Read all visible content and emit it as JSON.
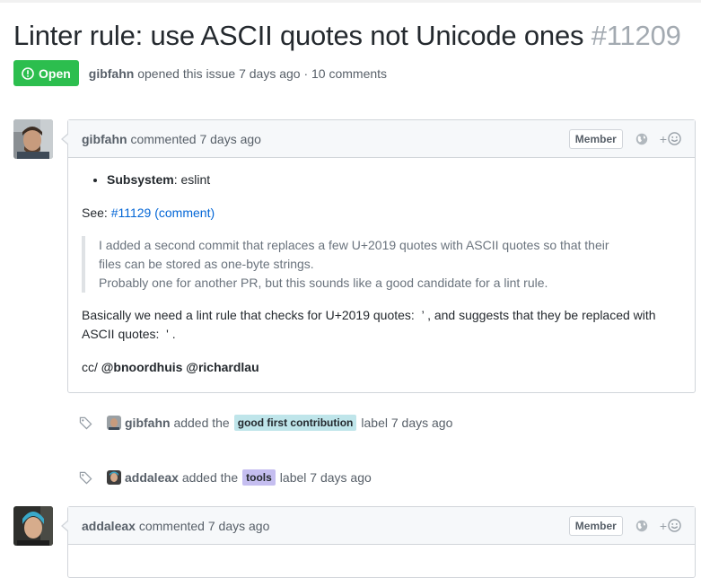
{
  "issue": {
    "title": "Linter rule: use ASCII quotes not Unicode ones",
    "number": "#11209",
    "status": "Open",
    "opener": "gibfahn",
    "opened_text": "opened this issue 7 days ago · 10 comments"
  },
  "comments": [
    {
      "author": "gibfahn",
      "action": "commented 7 days ago",
      "role": "Member",
      "body": {
        "bullet_bold": "Subsystem",
        "bullet_rest": ": eslint",
        "see_label": "See:",
        "see_link": "#11129 (comment)",
        "quote_lines": [
          "I added a second commit that replaces a few U+2019 quotes with ASCII quotes so that their",
          "files can be stored as one-byte strings.",
          "Probably one for another PR, but this sounds like a good candidate for a lint rule."
        ],
        "para": "Basically we need a lint rule that checks for U+2019 quotes:  ’ , and suggests that they be replaced with ASCII quotes:  ' .",
        "cc_prefix": "cc/ ",
        "cc_mentions": "@bnoordhuis @richardlau"
      }
    },
    {
      "author": "addaleax",
      "action": "commented 7 days ago",
      "role": "Member"
    }
  ],
  "events": [
    {
      "actor": "gibfahn",
      "verb": "added the",
      "label": "good first contribution",
      "suffix": "label 7 days ago",
      "label_color": "#bfe5ea"
    },
    {
      "actor": "addaleax",
      "verb": "added the",
      "label": "tools",
      "suffix": "label 7 days ago",
      "label_color": "#c5bef0"
    }
  ],
  "icons": {
    "status": "alert-circle-icon",
    "event": "tag-icon",
    "globe": "globe-icon",
    "reaction": "smiley-icon"
  },
  "colors": {
    "open_green": "#2cbe4e",
    "link_blue": "#0366d6"
  }
}
